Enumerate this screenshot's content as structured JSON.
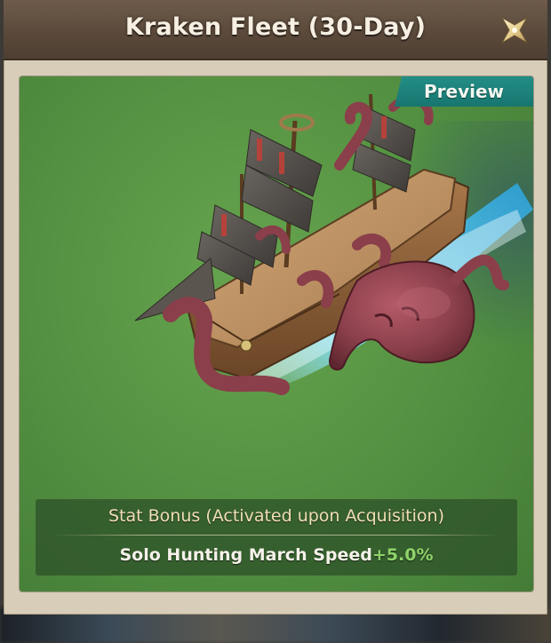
{
  "dialog": {
    "title": "Kraken Fleet (30-Day)",
    "close_icon": "close-x-icon"
  },
  "preview": {
    "label": "Preview"
  },
  "stat_bonus": {
    "title": "Stat Bonus (Activated upon Acquisition)",
    "stats": [
      {
        "name": "Solo Hunting March Speed",
        "value": "+5.0%"
      }
    ]
  },
  "colors": {
    "title_bar": "#5b4a3b",
    "preview_tag": "#1e857d",
    "grass": "#5a9846",
    "stat_value": "#8fd36a",
    "kraken": "#8a3f4a"
  }
}
